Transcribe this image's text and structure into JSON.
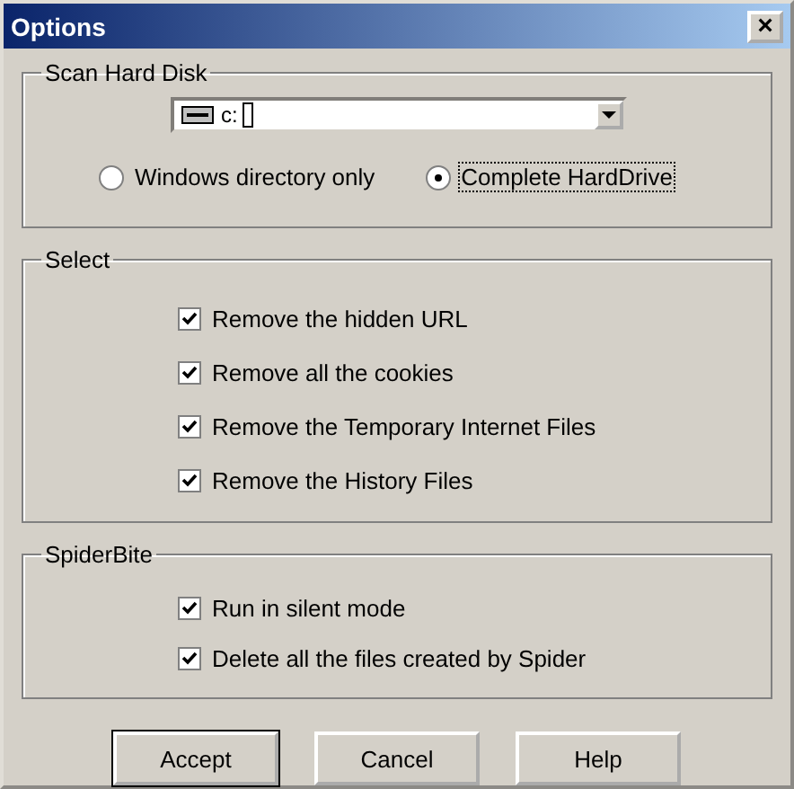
{
  "window": {
    "title": "Options",
    "close": "×"
  },
  "scan_hard_disk": {
    "title": "Scan Hard Disk",
    "drive": {
      "value": "c:"
    },
    "options": [
      {
        "label": "Windows directory only",
        "selected": false,
        "focused": false
      },
      {
        "label": "Complete HardDrive",
        "selected": true,
        "focused": true
      }
    ]
  },
  "select": {
    "title": "Select",
    "items": [
      {
        "label": "Remove the hidden URL",
        "checked": true
      },
      {
        "label": "Remove all the cookies",
        "checked": true
      },
      {
        "label": "Remove the Temporary Internet Files",
        "checked": true
      },
      {
        "label": "Remove the History Files",
        "checked": true
      }
    ]
  },
  "spiderbite": {
    "title": "SpiderBite",
    "items": [
      {
        "label": "Run in silent mode",
        "checked": true
      },
      {
        "label": "Delete all the files created by Spider",
        "checked": true
      }
    ]
  },
  "buttons": [
    {
      "label": "Accept",
      "default": true
    },
    {
      "label": "Cancel",
      "default": false
    },
    {
      "label": "Help",
      "default": false
    }
  ]
}
